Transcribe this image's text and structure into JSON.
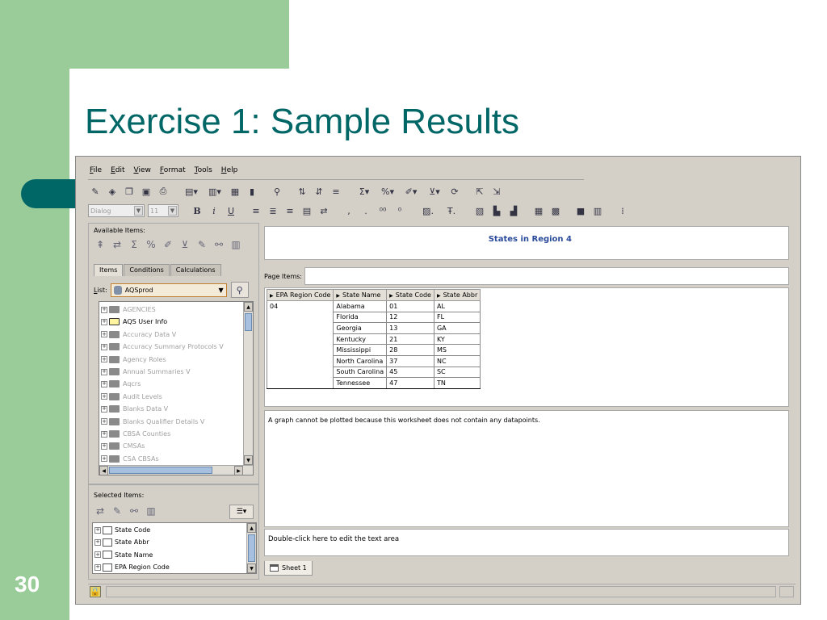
{
  "slide": {
    "title": "Exercise 1: Sample Results",
    "number": "30"
  },
  "menu": [
    "File",
    "Edit",
    "View",
    "Format",
    "Tools",
    "Help"
  ],
  "format_toolbar": {
    "font_name": "Dialog",
    "font_size": "11",
    "bold": "B",
    "italic": "i",
    "underline": "U"
  },
  "left_panel": {
    "available_label": "Available Items:",
    "tabs": [
      "Items",
      "Conditions",
      "Calculations"
    ],
    "list_label": "List:",
    "list_value": "AQSprod",
    "folders": [
      {
        "name": "AGENCIES",
        "active": false
      },
      {
        "name": "AQS User Info",
        "active": true
      },
      {
        "name": "Accuracy Data V",
        "active": false
      },
      {
        "name": "Accuracy Summary Protocols V",
        "active": false
      },
      {
        "name": "Agency Roles",
        "active": false
      },
      {
        "name": "Annual Summaries V",
        "active": false
      },
      {
        "name": "Aqcrs",
        "active": false
      },
      {
        "name": "Audit Levels",
        "active": false
      },
      {
        "name": "Blanks Data V",
        "active": false
      },
      {
        "name": "Blanks Qualifier Details V",
        "active": false
      },
      {
        "name": "CBSA Counties",
        "active": false
      },
      {
        "name": "CMSAs",
        "active": false
      },
      {
        "name": "CSA CBSAs",
        "active": false
      }
    ],
    "selected_label": "Selected Items:",
    "selected_items": [
      "State Code",
      "State Abbr",
      "State Name",
      "EPA Region Code"
    ]
  },
  "worksheet": {
    "title": "States in Region 4",
    "page_items_label": "Page Items:",
    "columns": [
      "EPA Region Code",
      "State Name",
      "State Code",
      "State Abbr"
    ],
    "rows": [
      [
        "04",
        "Alabama",
        "01",
        "AL"
      ],
      [
        "",
        "Florida",
        "12",
        "FL"
      ],
      [
        "",
        "Georgia",
        "13",
        "GA"
      ],
      [
        "",
        "Kentucky",
        "21",
        "KY"
      ],
      [
        "",
        "Mississippi",
        "28",
        "MS"
      ],
      [
        "",
        "North Carolina",
        "37",
        "NC"
      ],
      [
        "",
        "South Carolina",
        "45",
        "SC"
      ],
      [
        "",
        "Tennessee",
        "47",
        "TN"
      ]
    ],
    "graph_message": "A graph cannot be plotted because this worksheet does not contain any datapoints.",
    "text_area": "Double-click here to edit the text area",
    "sheet_tab": "Sheet 1"
  },
  "colors": {
    "slide_green": "#99cc99",
    "slide_teal": "#006666",
    "title_blue": "#2a4a9a"
  }
}
